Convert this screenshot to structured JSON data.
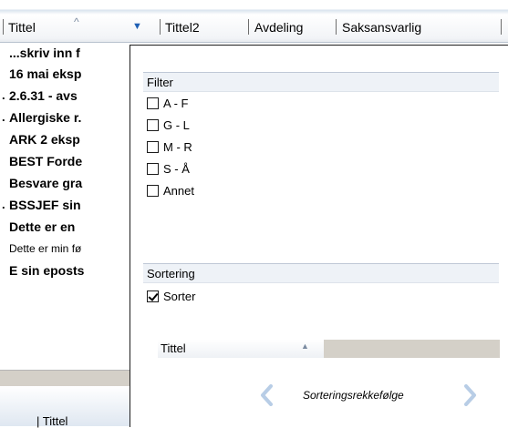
{
  "header": {
    "columns": [
      "Tittel",
      "Tittel2",
      "Avdeling",
      "Saksansvarlig"
    ],
    "sort_indicator": "^",
    "dropdown_indicator": "▼"
  },
  "list": {
    "rows": [
      {
        "prefix": "",
        "text": "...skriv inn f"
      },
      {
        "prefix": "",
        "text": "16 mai eksp"
      },
      {
        "prefix": ".",
        "text": "2.6.31 - avs"
      },
      {
        "prefix": ".",
        "text": "Allergiske r."
      },
      {
        "prefix": "",
        "text": "ARK 2 eksp"
      },
      {
        "prefix": "",
        "text": "BEST Forde"
      },
      {
        "prefix": "",
        "text": "Besvare gra"
      },
      {
        "prefix": ".",
        "text": "BSSJEF sin"
      },
      {
        "prefix": "",
        "text": "Dette er en"
      },
      {
        "prefix": "",
        "text": "Dette er min fø"
      },
      {
        "prefix": "",
        "text": "E sin eposts"
      }
    ]
  },
  "bottom_header": {
    "label": "| Tittel"
  },
  "panel": {
    "filter_title": "Filter",
    "filter_options": [
      {
        "label": "A - F",
        "checked": false
      },
      {
        "label": "G - L",
        "checked": false
      },
      {
        "label": "M - R",
        "checked": false
      },
      {
        "label": "S - Å",
        "checked": false
      },
      {
        "label": "Annet",
        "checked": false
      }
    ],
    "sort_title": "Sortering",
    "sort_option": {
      "label": "Sorter",
      "checked": true
    },
    "sort_field": "Tittel",
    "sort_order_label": "Sorteringsrekkefølge"
  },
  "colors": {
    "nav_arrow": "#b8cde6",
    "section_bg": "#eef2f7",
    "gray_fill": "#d4d0c8"
  }
}
